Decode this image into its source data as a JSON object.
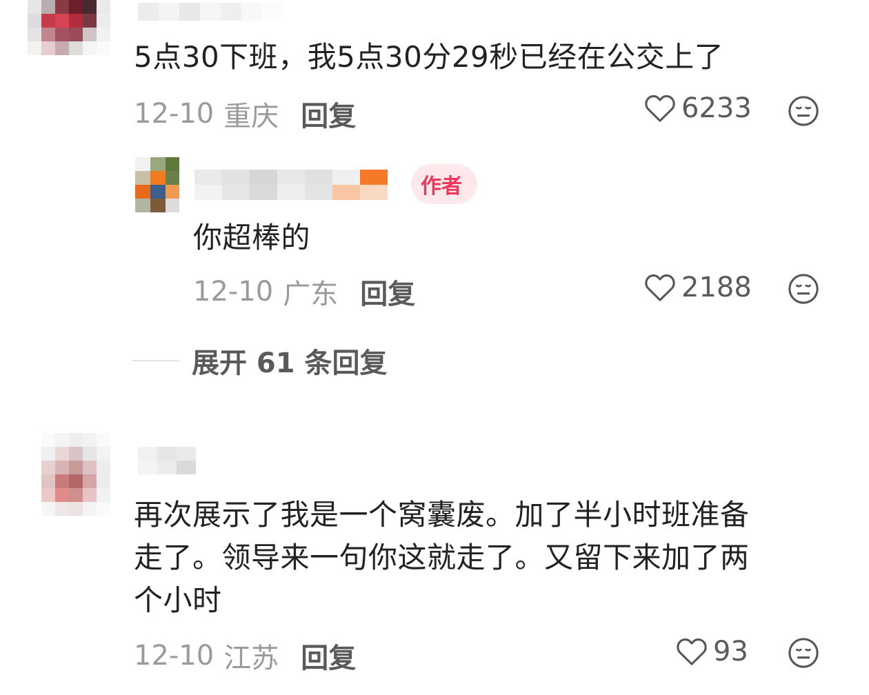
{
  "comments": [
    {
      "text": "5点30下班，我5点30分29秒已经在公交上了",
      "date": "12-10",
      "location": "重庆",
      "reply_label": "回复",
      "likes": "6233"
    },
    {
      "text": "你超棒的",
      "badge": "作者",
      "date": "12-10",
      "location": "广东",
      "reply_label": "回复",
      "likes": "2188"
    },
    {
      "text_lines": [
        "再次展示了我是一个窝囊废。加了半小时班准备",
        "走了。领导来一句你这就走了。又留下来加了两",
        "个小时"
      ],
      "date": "12-10",
      "location": "江苏",
      "reply_label": "回复",
      "likes": "93"
    }
  ],
  "expand_replies_label": "展开 61 条回复",
  "icons": {
    "like": "heart-outline-icon",
    "dislike": "meh-face-icon"
  },
  "colors": {
    "author_badge_bg": "#fde8ec",
    "author_badge_text": "#f1365a",
    "meta_gray": "#9a9a9a"
  }
}
